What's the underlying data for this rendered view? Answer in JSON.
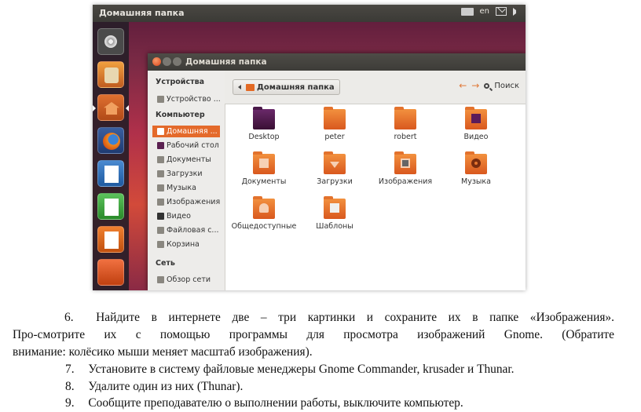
{
  "screenshot": {
    "topbar": {
      "title": "Домашняя папка",
      "keyboard_layout": "en",
      "icons": [
        "keyboard-icon",
        "mail-icon",
        "sound-icon"
      ]
    },
    "launcher": {
      "items": [
        "dash-icon",
        "software-center-icon",
        "home-folder-icon",
        "firefox-icon",
        "writer-icon",
        "calc-icon",
        "impress-icon",
        "extra-app-icon"
      ]
    },
    "window": {
      "title": "Домашняя папка",
      "breadcrumb": "Домашняя папка",
      "search_label": "Поиск",
      "sidebar": {
        "sections": [
          {
            "header": "Устройства",
            "items": [
              "Устройство ..."
            ]
          },
          {
            "header": "Компьютер",
            "items": [
              "Домашняя ...",
              "Рабочий стол",
              "Документы",
              "Загрузки",
              "Музыка",
              "Изображения",
              "Видео",
              "Файловая с...",
              "Корзина"
            ]
          },
          {
            "header": "Сеть",
            "items": [
              "Обзор сети"
            ]
          }
        ],
        "active_item": "Домашняя ..."
      },
      "files": [
        {
          "name": "Desktop",
          "icon": "desktop-folder-icon"
        },
        {
          "name": "peter",
          "icon": "folder-icon"
        },
        {
          "name": "robert",
          "icon": "folder-icon"
        },
        {
          "name": "Видео",
          "icon": "video-folder-icon"
        },
        {
          "name": "Документы",
          "icon": "documents-folder-icon"
        },
        {
          "name": "Загрузки",
          "icon": "downloads-folder-icon"
        },
        {
          "name": "Изображения",
          "icon": "pictures-folder-icon"
        },
        {
          "name": "Музыка",
          "icon": "music-folder-icon"
        },
        {
          "name": "Общедоступные",
          "icon": "public-folder-icon"
        },
        {
          "name": "Шаблоны",
          "icon": "templates-folder-icon"
        }
      ],
      "colors": {
        "accent": "#e46a2b",
        "titlebar": "#3d3c38"
      }
    }
  },
  "instructions": [
    {
      "number": "6.",
      "lines": [
        "Найдите в интернете две – три картинки и сохраните их в папке «Изображения».",
        "Про-смотрите их с помощью программы для просмотра изображений Gnome. (Обратите",
        "внимание: колёсико мыши меняет масштаб изображения)."
      ]
    },
    {
      "number": "7.",
      "lines": [
        "Установите в систему файловые менеджеры Gnome Commander, krusader и Thunar."
      ]
    },
    {
      "number": "8.",
      "lines": [
        "Удалите один из них (Thunar)."
      ]
    },
    {
      "number": "9.",
      "lines": [
        "Сообщите преподавателю о выполнении работы, выключите компьютер."
      ]
    }
  ]
}
